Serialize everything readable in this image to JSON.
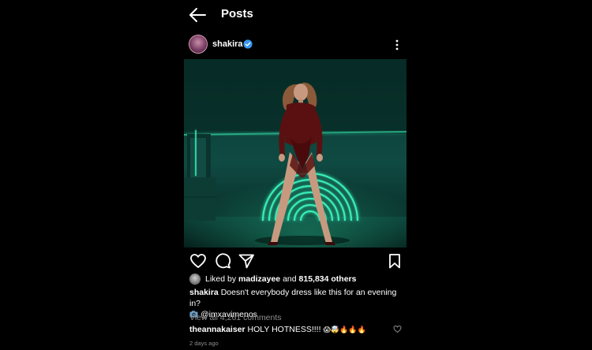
{
  "header": {
    "title": "Posts",
    "back_icon": "arrow-left-icon"
  },
  "post": {
    "username": "shakira",
    "verified": true,
    "more_icon": "kebab-menu-icon",
    "photo_description_icon": "photo-neon-rainbow",
    "actions": [
      "heart-icon",
      "comment-icon",
      "share-icon",
      "bookmark-icon"
    ],
    "likes": {
      "prefix": "Liked by ",
      "user": "madizayee",
      "middle": " and ",
      "count": "815,834 others"
    },
    "caption": {
      "user": "shakira",
      "text": "Doesn't everybody dress like this for an evening in?",
      "credit": "@imxavimenos"
    },
    "view_all": "View all 4,261 comments",
    "comment": {
      "user": "theannakaiser",
      "text": "HOLY HOTNESS!!!! ",
      "emojis": "😱🤯🔥🔥🔥"
    },
    "timestamp": "2 days ago"
  },
  "colors": {
    "background": "#000000",
    "verified_blue": "#3897f0",
    "muted": "#8e8e8e",
    "neon": "#3dffc2"
  }
}
